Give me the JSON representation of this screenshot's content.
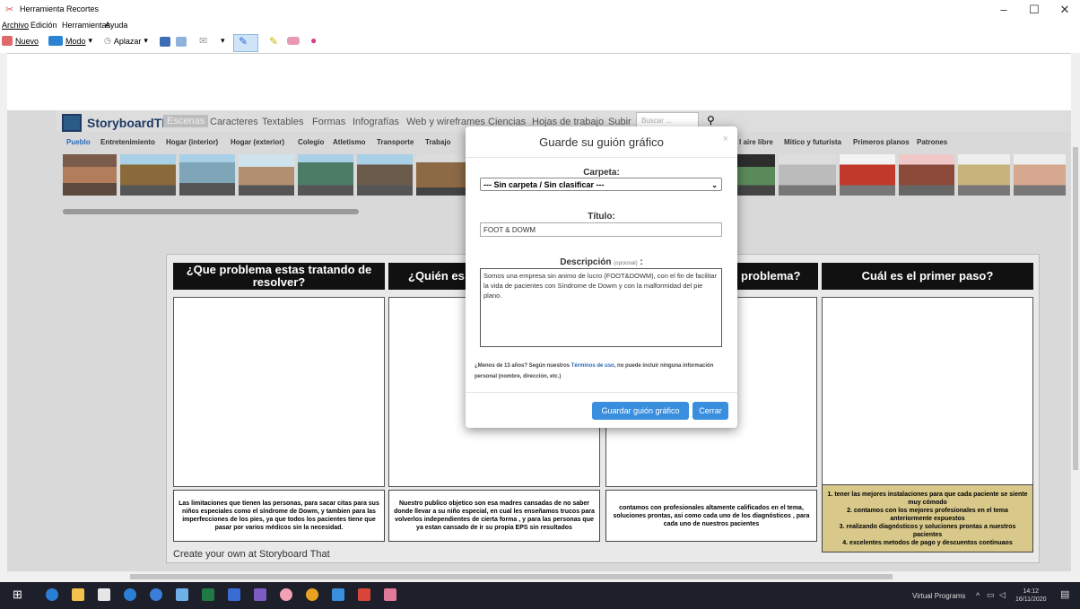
{
  "window": {
    "title": "Herramienta Recortes",
    "minimize": "–",
    "maximize": "☐",
    "close": "✕"
  },
  "menu": [
    "Archivo",
    "Edición",
    "Herramientas",
    "Ayuda"
  ],
  "toolbar": {
    "nuevo": "Nuevo",
    "modo": "Modo",
    "aplazar": "Aplazar"
  },
  "storyboard": {
    "brand": "StoryboardThat",
    "nav": [
      "Escenas",
      "Caracteres",
      "Textables",
      "Formas",
      "Infografías",
      "Web y wireframes",
      "Ciencias",
      "Hojas de trabajo",
      "Subir"
    ],
    "search_placeholder": "Buscar ...",
    "subcats_left": [
      "Pueblo",
      "Entretenimiento",
      "Hogar (interior)",
      "Hogar (exterior)",
      "Colegio",
      "Atletismo",
      "Transporte",
      "Trabajo"
    ],
    "subcats_right": [
      "l aire libre",
      "Mítico y futurista",
      "Primeros planos",
      "Patrones"
    ],
    "columns": [
      {
        "heading": "¿Que problema estas tratando de resolver?",
        "caption": "Las limitaciones que tienen las personas, para sacar citas para sus niños especiales como el síndrome de Dowm, y tambien para las imperfecciones de los pies, ya que todos los pacientes tiene que pasar  por varios médicos sin la necesidad."
      },
      {
        "heading": "¿Quién es",
        "caption": "Nuestro publico objetico son esa madres cansadas de no saber donde llevar a su niño especial, en cual les enseñamos trucos para volverlos independientes de cierta forma , y para las personas que ya estan cansado de ir su propia EPS sin resultados"
      },
      {
        "heading": "problema?",
        "caption": "contamos con profesionales altamente calificados en el tema, soluciones prontas, asi como cada uno de los diagnósticos , para cada uno de nuestros pacientes"
      },
      {
        "heading": "Cuál es el primer paso?",
        "caption": "1. tener las mejores instalaciones para que cada paciente se siente muy cómodo\n2. contamos con los mejores profesionales en el tema anteriormente expuestos\n3. realizando diagnósticos y soluciones prontas a nuestros pacientes\n4. excelentes metodos de pago y descuentos continuaos"
      }
    ],
    "create_own": "Create your own at Storyboard That"
  },
  "modal": {
    "title": "Guarde su guión gráfico",
    "close_x": "×",
    "folder_label": "Carpeta:",
    "folder_value": "--- Sin carpeta / Sin clasificar ---",
    "title_label": "Título:",
    "title_value": "FOOT & DOWM",
    "desc_label": "Descripción",
    "desc_optional": "(opcional)",
    "desc_suffix": " :",
    "desc_value": "Somos una empresa sin animo de lucro (FOOT&DOWM), con el fin de facilitar la vida de pacientes con Síndrome de Dowm y con la malformidad del pie plano.",
    "notice_pre": "¿Menos de 13 años? Según nuestros ",
    "notice_link": "Términos de uso",
    "notice_post": ", no puede incluir ninguna información personal (nombre, dirección, etc.)",
    "save_button": "Guardar guión gráfico",
    "close_button": "Cerrar"
  },
  "taskbar": {
    "tray_label": "Virtual Programs",
    "time": "14:12",
    "date": "16/11/2020"
  }
}
